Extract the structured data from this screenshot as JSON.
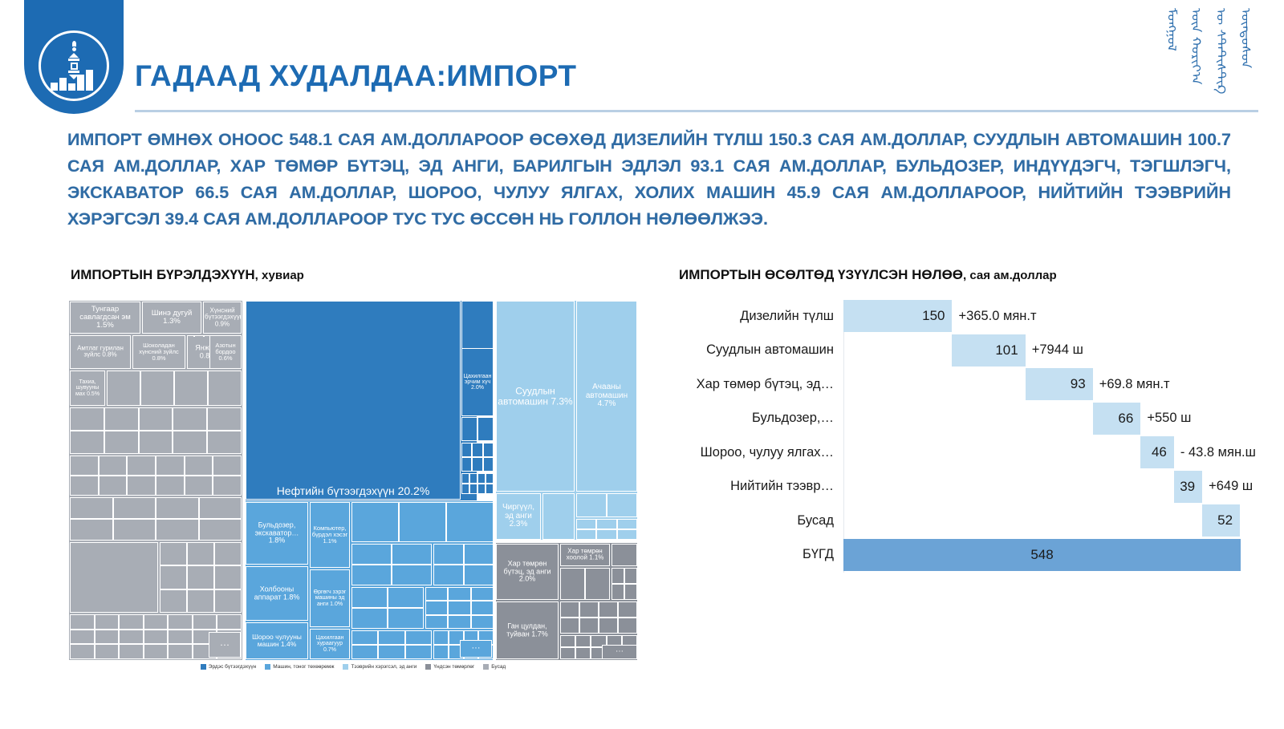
{
  "header": {
    "title": "ГАДААД ХУДАЛДАА:ИМПОРТ",
    "logo_name": "nso-mongolia-emblem",
    "mongol_script": [
      "ᠦᠨᠳᠦᠰᠦᠨ",
      "ᠦ ᠰᠲ᠋ᠠᠲ᠋ᠢᠰᠲ᠋ᠢᠺ",
      "ᠦᠨ ᠬᠣᠷᠢᠶ᠎ᠠ",
      "ᠮᠣᠩᠭᠣᠯ"
    ]
  },
  "lead_paragraph": "ИМПОРТ ӨМНӨХ ОНООС 548.1 САЯ АМ.ДОЛЛАРООР ӨСӨХӨД ДИЗЕЛИЙН ТҮЛШ 150.3 САЯ АМ.ДОЛЛАР, СУУДЛЫН АВТОМАШИН 100.7 САЯ АМ.ДОЛЛАР, ХАР ТӨМӨР БҮТЭЦ, ЭД АНГИ, БАРИЛГЫН ЭДЛЭЛ 93.1 САЯ АМ.ДОЛЛАР, БУЛЬДОЗЕР, ИНДҮҮДЭГЧ, ТЭГШЛЭГЧ, ЭКСКАВАТОР 66.5 САЯ АМ.ДОЛЛАР, ШОРОО, ЧУЛУУ ЯЛГАХ, ХОЛИХ МАШИН 45.9 САЯ АМ.ДОЛЛАРООР, НИЙТИЙН ТЭЭВРИЙН ХЭРЭГСЭЛ 39.4 САЯ АМ.ДОЛЛАРООР ТУС ТУС ӨССӨН НЬ ГОЛЛОН НӨЛӨӨЛЖЭЭ.",
  "left_panel": {
    "title_main": "ИМПОРТЫН БҮРЭЛДЭХҮҮН",
    "title_sub": ", хувиар"
  },
  "right_panel": {
    "title_main": "ИМПОРТЫН ӨСӨЛТӨД ҮЗҮҮЛСЭН НӨЛӨӨ",
    "title_sub": ", сая ам.доллар"
  },
  "colors": {
    "brand_blue": "#1d6bb3",
    "text_blue": "#2f6ba4",
    "mineral": "#2f7cbe",
    "machinery": "#5aa6dc",
    "transport": "#9fcfec",
    "metal": "#8b9099",
    "other": "#a8adb5",
    "wf_bar": "#c5e0f2",
    "wf_total": "#6ba3d6"
  },
  "chart_data": [
    {
      "type": "treemap",
      "title": "ИМПОРТЫН БҮРЭЛДЭХҮҮН, хувиар",
      "unit": "%",
      "legend": [
        {
          "label": "Эрдэс бүтээгдэхүүн",
          "color": "#2f7cbe"
        },
        {
          "label": "Машин, тоног төхөөрөмж",
          "color": "#5aa6dc"
        },
        {
          "label": "Тээврийн хэрэгсэл, эд анги",
          "color": "#9fcfec"
        },
        {
          "label": "Үндсэн төмөрлөг",
          "color": "#8b9099"
        },
        {
          "label": "Бусад",
          "color": "#a8adb5"
        }
      ],
      "labeled_items": [
        {
          "label": "Тунгаар савлагдсан эм",
          "value": 1.5,
          "group": "Бусад"
        },
        {
          "label": "Шинэ дугуй",
          "value": 1.3,
          "group": "Бусад"
        },
        {
          "label": "Хүнсний бүтээгдэхүүн",
          "value": 0.9,
          "group": "Бусад"
        },
        {
          "label": "Амтлаг гурилан зүйлс",
          "value": 0.8,
          "group": "Бусад"
        },
        {
          "label": "Шоколадан хүнсний зүйлс",
          "value": 0.8,
          "group": "Бусад"
        },
        {
          "label": "Янжуур",
          "value": 0.8,
          "group": "Бусад"
        },
        {
          "label": "Азотын бордоо",
          "value": 0.6,
          "group": "Бусад"
        },
        {
          "label": "Тахиа, шувууны мах",
          "value": 0.5,
          "group": "Бусад"
        },
        {
          "label": "Нефтийн бүтээгдэхүүн",
          "value": 20.2,
          "group": "Эрдэс бүтээгдэхүүн"
        },
        {
          "label": "Цахилгаан эрчим хүч",
          "value": 2.0,
          "group": "Эрдэс бүтээгдэхүүн"
        },
        {
          "label": "Бульдозер, экскаватор…",
          "value": 1.8,
          "group": "Машин, тоног төхөөрөмж"
        },
        {
          "label": "Холбооны аппарат",
          "value": 1.8,
          "group": "Машин, тоног төхөөрөмж"
        },
        {
          "label": "Шороо чулууны машин",
          "value": 1.4,
          "group": "Машин, тоног төхөөрөмж"
        },
        {
          "label": "Компьютер, бүрдэл хэсэг",
          "value": 1.1,
          "group": "Машин, тоног төхөөрөмж"
        },
        {
          "label": "Өргөгч зэрэг машины эд анги",
          "value": 1.0,
          "group": "Машин, тоног төхөөрөмж"
        },
        {
          "label": "Цахилгаан хураагуур",
          "value": 0.7,
          "group": "Машин, тоног төхөөрөмж"
        },
        {
          "label": "Суудлын автомашин",
          "value": 7.3,
          "group": "Тээврийн хэрэгсэл, эд анги"
        },
        {
          "label": "Ачааны автомашин",
          "value": 4.7,
          "group": "Тээврийн хэрэгсэл, эд анги"
        },
        {
          "label": "Чиргүүл, эд анги",
          "value": 2.3,
          "group": "Тээврийн хэрэгсэл, эд анги"
        },
        {
          "label": "Хар төмрөн бүтэц, эд анги",
          "value": 2.0,
          "group": "Үндсэн төмөрлөг"
        },
        {
          "label": "Ган цулдан, туйван",
          "value": 1.7,
          "group": "Үндсэн төмөрлөг"
        },
        {
          "label": "Хар төмрөн хоолой",
          "value": 1.1,
          "group": "Үндсэн төмөрлөг"
        }
      ]
    },
    {
      "type": "bar",
      "subtype": "waterfall",
      "title": "ИМПОРТЫН ӨСӨЛТӨД ҮЗҮҮЛСЭН НӨЛӨӨ, сая ам.доллар",
      "ylabel": "",
      "xlabel": "сая ам.доллар",
      "categories": [
        "Дизелийн түлш",
        "Суудлын автомашин",
        "Хар төмөр бүтэц, эд…",
        "Бульдозер,…",
        "Шороо, чулуу ялгах…",
        "Нийтийн тээвр…",
        "Бусад",
        "БҮГД"
      ],
      "values": [
        150,
        101,
        93,
        66,
        46,
        39,
        52,
        548
      ],
      "cumulative_start": [
        0,
        150,
        251,
        344,
        410,
        456,
        495,
        0
      ],
      "annotations": [
        "+365.0 мян.т",
        "+7944 ш",
        "+69.8 мян.т",
        "+550 ш",
        "- 43.8 мян.ш",
        "+649 ш",
        "",
        ""
      ],
      "total_row_index": 7,
      "axis_max": 548
    }
  ]
}
